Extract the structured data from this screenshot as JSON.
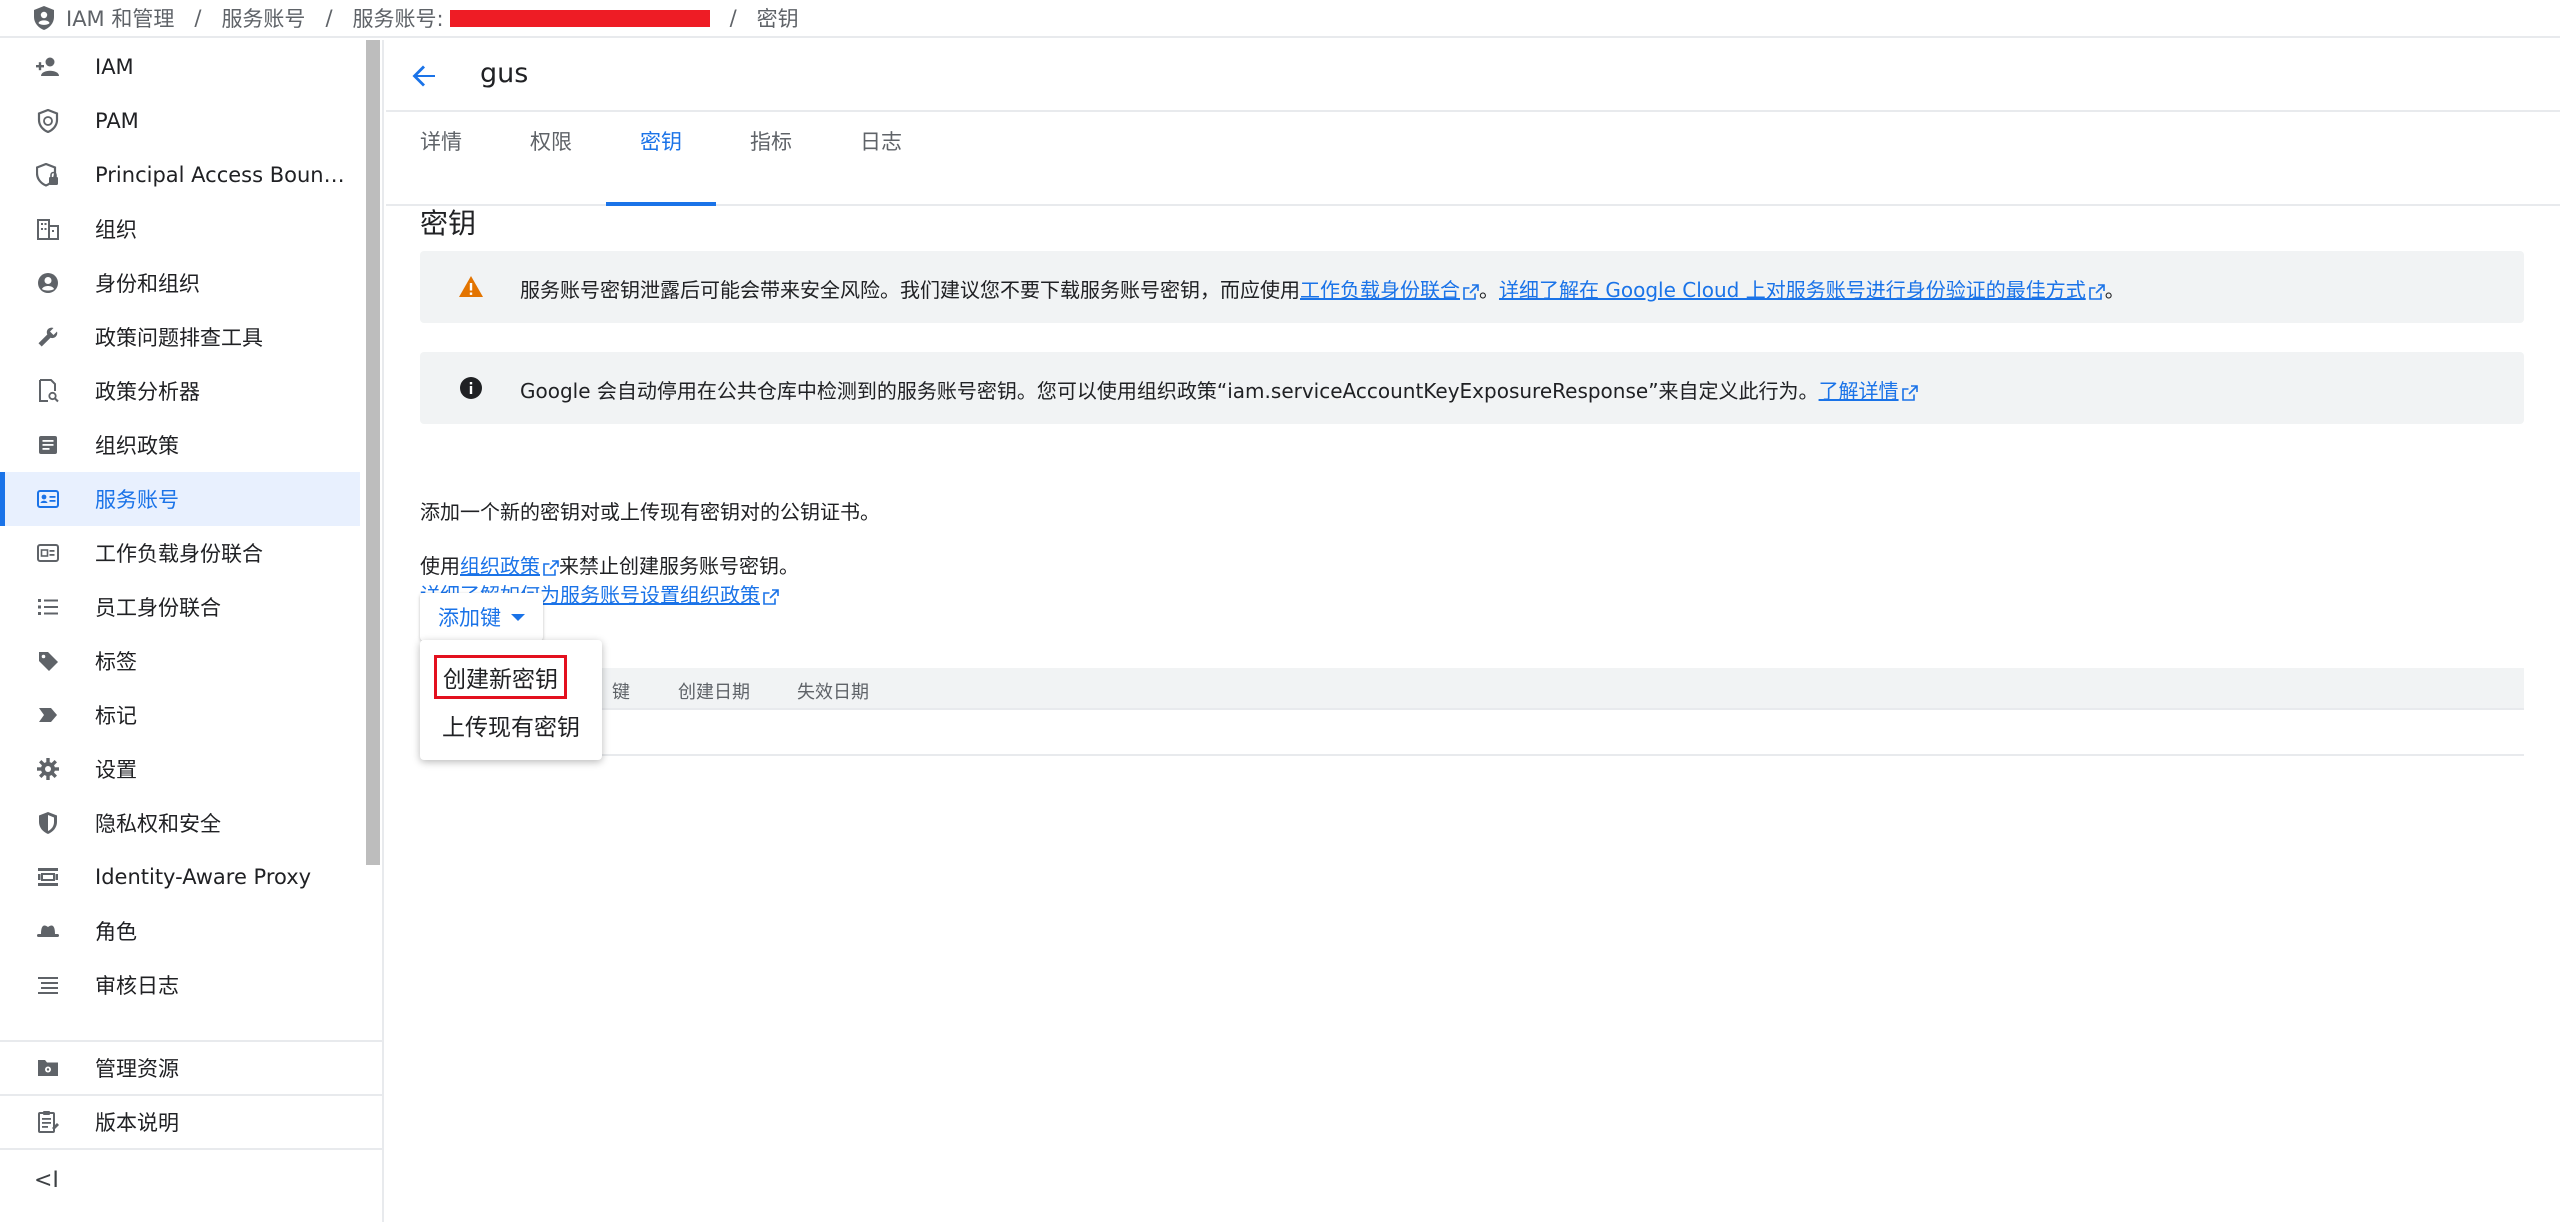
{
  "breadcrumb": {
    "items": [
      "IAM 和管理",
      "服务账号",
      "服务账号:",
      "密钥"
    ],
    "separator": "/"
  },
  "sidebar": {
    "items": [
      {
        "label": "IAM",
        "icon": "person-add-icon"
      },
      {
        "label": "PAM",
        "icon": "shield-clock-icon"
      },
      {
        "label": "Principal Access Boun…",
        "icon": "shield-lock-icon"
      },
      {
        "label": "组织",
        "icon": "building-icon"
      },
      {
        "label": "身份和组织",
        "icon": "account-circle-icon"
      },
      {
        "label": "政策问题排查工具",
        "icon": "wrench-icon"
      },
      {
        "label": "政策分析器",
        "icon": "document-search-icon"
      },
      {
        "label": "组织政策",
        "icon": "article-icon"
      },
      {
        "label": "服务账号",
        "icon": "badge-icon",
        "active": true
      },
      {
        "label": "工作负载身份联合",
        "icon": "id-card-icon"
      },
      {
        "label": "员工身份联合",
        "icon": "list-icon"
      },
      {
        "label": "标签",
        "icon": "tag-icon"
      },
      {
        "label": "标记",
        "icon": "label-icon"
      },
      {
        "label": "设置",
        "icon": "gear-icon"
      },
      {
        "label": "隐私权和安全",
        "icon": "shield-icon"
      },
      {
        "label": "Identity-Aware Proxy",
        "icon": "proxy-icon"
      },
      {
        "label": "角色",
        "icon": "hat-icon"
      },
      {
        "label": "审核日志",
        "icon": "lines-icon"
      }
    ],
    "bottom": [
      {
        "label": "管理资源",
        "icon": "folder-gear-icon"
      },
      {
        "label": "版本说明",
        "icon": "release-notes-icon"
      }
    ],
    "collapse_icon": "collapse-icon",
    "collapse_label": "<I"
  },
  "header": {
    "title": "gus",
    "back_icon": "arrow-back-icon"
  },
  "tabs": [
    {
      "label": "详情"
    },
    {
      "label": "权限"
    },
    {
      "label": "密钥",
      "active": true
    },
    {
      "label": "指标"
    },
    {
      "label": "日志"
    }
  ],
  "section": {
    "title": "密钥"
  },
  "warning_banner": {
    "icon": "warning-icon",
    "text_before": "服务账号密钥泄露后可能会带来安全风险。我们建议您不要下载服务账号密钥，而应使用",
    "link1": "工作负载身份联合",
    "middle": "。",
    "link2": "详细了解在 Google Cloud 上对服务账号进行身份验证的最佳方式",
    "end": "。"
  },
  "info_banner": {
    "icon": "info-icon",
    "text": "Google 会自动停用在公共仓库中检测到的服务账号密钥。您可以使用组织政策“iam.serviceAccountKeyExposureResponse”来自定义此行为。",
    "link": "了解详情"
  },
  "description": "添加一个新的密钥对或上传现有密钥对的公钥证书。",
  "org_policy": {
    "before": "使用",
    "link": "组织政策",
    "after": "来禁止创建服务账号密钥。",
    "learn_link": "详细了解如何为服务账号设置组织政策"
  },
  "add_key_button": "添加键",
  "dropdown": {
    "options": [
      "创建新密钥",
      "上传现有密钥"
    ]
  },
  "table": {
    "headers": [
      "键",
      "创建日期",
      "失效日期"
    ]
  },
  "colors": {
    "accent": "#1a73e8",
    "warning": "#e37400",
    "highlight_border": "#e3101e",
    "redaction": "#ee1c25"
  }
}
